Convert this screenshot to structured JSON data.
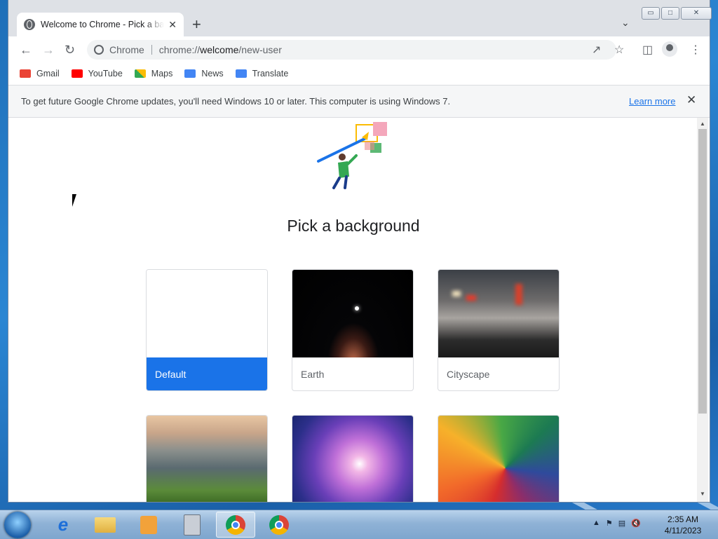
{
  "browser": {
    "tab_title": "Welcome to Chrome - Pick a background",
    "tab_close": "✕",
    "new_tab": "+",
    "tab_search": "⌄",
    "window_buttons": [
      "▭",
      "□",
      "✕"
    ],
    "omnibox": {
      "chip": "Chrome",
      "url_prefix": "chrome://",
      "url_host": "welcome",
      "url_path": "/new-user"
    },
    "bookmarks": [
      {
        "label": "Gmail",
        "color": "#ea4335"
      },
      {
        "label": "YouTube",
        "color": "#ff0000"
      },
      {
        "label": "Maps",
        "color": "#34a853"
      },
      {
        "label": "News",
        "color": "#4285f4"
      },
      {
        "label": "Translate",
        "color": "#4285f4"
      }
    ],
    "infobar": {
      "message": "To get future Google Chrome updates, you'll need Windows 10 or later. This computer is using Windows 7.",
      "link": "Learn more",
      "close": "✕"
    }
  },
  "page": {
    "heading": "Pick a background",
    "cards": [
      {
        "label": "Default",
        "selected": true
      },
      {
        "label": "Earth"
      },
      {
        "label": "Cityscape"
      },
      {
        "label": ""
      },
      {
        "label": ""
      },
      {
        "label": ""
      }
    ]
  },
  "taskbar": {
    "time": "2:35 AM",
    "date": "4/11/2023"
  },
  "colors": {
    "accent": "#1a73e8"
  }
}
